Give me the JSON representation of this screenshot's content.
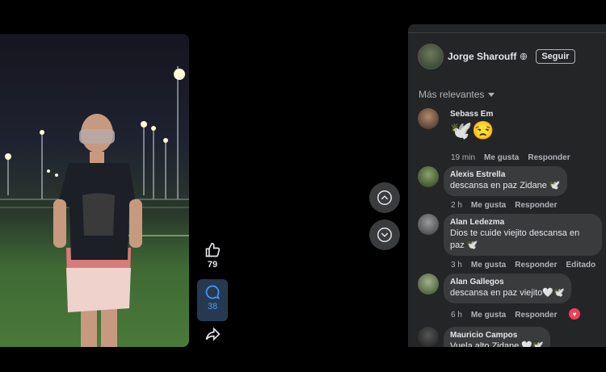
{
  "video": {
    "subject": "man standing on a lit football field at night"
  },
  "rail": {
    "like_count": "79",
    "comment_count": "38"
  },
  "panel": {
    "author_name": "Jorge Sharouff",
    "follow_label": "Seguir",
    "sort_label": "Más relevantes"
  },
  "comments": [
    {
      "name": "Sebass Em",
      "text": "🕊️😒",
      "time": "19 min",
      "like": "Me gusta",
      "reply": "Responder",
      "edited": ""
    },
    {
      "name": "Alexis Estrella",
      "text": "descansa en paz Zidane 🕊️",
      "time": "2 h",
      "like": "Me gusta",
      "reply": "Responder",
      "edited": ""
    },
    {
      "name": "Alan Ledezma",
      "text": "Dios te cuide viejito descansa en paz 🕊️",
      "time": "3 h",
      "like": "Me gusta",
      "reply": "Responder",
      "edited": "Editado"
    },
    {
      "name": "Alan Gallegos",
      "text": "descansa en paz viejito🤍🕊️",
      "time": "6 h",
      "like": "Me gusta",
      "reply": "Responder",
      "edited": ""
    },
    {
      "name": "Mauricio Campos",
      "text": "Vuela alto Zidane 🤍🕊️",
      "time": "",
      "like": "",
      "reply": "",
      "edited": ""
    }
  ],
  "colors": {
    "accent": "#4599ff",
    "panel": "#242526",
    "bubble": "#3a3b3c",
    "heart": "#f33e58"
  }
}
